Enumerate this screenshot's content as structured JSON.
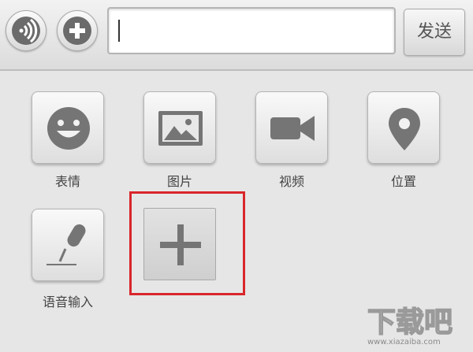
{
  "toolbar": {
    "voice_icon": "voice-signal-icon",
    "add_icon": "plus-circle-icon",
    "input_value": "",
    "send_label": "发送"
  },
  "panel": {
    "items": [
      {
        "label": "表情",
        "icon": "smiley-face-icon"
      },
      {
        "label": "图片",
        "icon": "picture-icon"
      },
      {
        "label": "视频",
        "icon": "video-camera-icon"
      },
      {
        "label": "位置",
        "icon": "location-pin-icon"
      },
      {
        "label": "语音输入",
        "icon": "microphone-icon"
      }
    ],
    "add_button_icon": "plus-icon"
  },
  "watermark": {
    "text": "下载吧",
    "domain": "www.xiazaiba.com"
  },
  "colors": {
    "highlight": "#d8262b",
    "icon_gray": "#757575"
  }
}
